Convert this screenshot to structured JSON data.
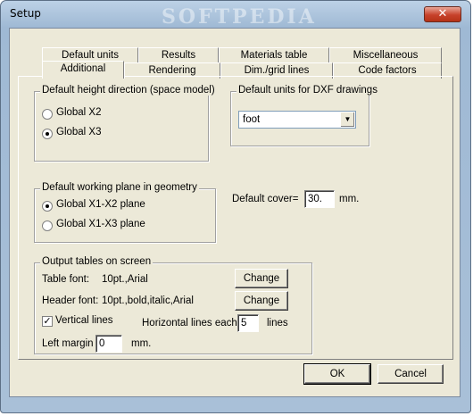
{
  "window": {
    "title": "Setup",
    "close_glyph": "✕",
    "watermark": "SOFTPEDIA"
  },
  "tabs_row1": [
    "Default units",
    "Results",
    "Materials table",
    "Miscellaneous"
  ],
  "tabs_row2": [
    "Additional",
    "Rendering",
    "Dim./grid lines",
    "Code factors"
  ],
  "active_tab": "Additional",
  "height_dir": {
    "legend": "Default height direction (space model)",
    "options": [
      "Global X2",
      "Global X3"
    ],
    "selected": "Global X3"
  },
  "dxf": {
    "legend": "Default units for DXF drawings",
    "value": "foot"
  },
  "working_plane": {
    "legend": "Default working plane in geometry",
    "options": [
      "Global X1-X2 plane",
      "Global X1-X3 plane"
    ],
    "selected": "Global X1-X2 plane"
  },
  "cover": {
    "label": "Default cover=",
    "value": "30.",
    "unit": "mm."
  },
  "output": {
    "legend": "Output tables on screen",
    "table_font_label": "Table font:",
    "table_font_value": "10pt.,Arial",
    "header_font_label": "Header font:",
    "header_font_value": "10pt.,bold,italic,Arial",
    "change_label": "Change",
    "vertical_lines_label": "Vertical lines",
    "vertical_lines_checked": true,
    "horizontal_label": "Horizontal lines each",
    "horizontal_value": "5",
    "horizontal_unit": "lines",
    "left_margin_label": "Left margin",
    "left_margin_value": "0",
    "left_margin_unit": "mm."
  },
  "footer": {
    "ok": "OK",
    "cancel": "Cancel"
  }
}
